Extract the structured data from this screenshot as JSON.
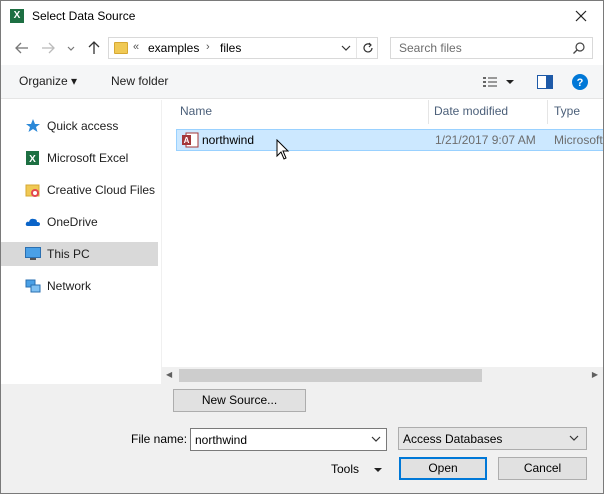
{
  "window": {
    "title": "Select Data Source",
    "app_icon_letter": "X"
  },
  "address": {
    "overflow": "«",
    "crumbs": [
      "examples",
      "files"
    ],
    "search_placeholder": "Search files"
  },
  "toolbar": {
    "organize_label": "Organize ▾",
    "new_folder_label": "New folder"
  },
  "sidebar": {
    "items": [
      {
        "label": "Quick access",
        "icon": "quick-access-star-icon"
      },
      {
        "label": "Microsoft Excel",
        "icon": "excel-icon"
      },
      {
        "label": "Creative Cloud Files",
        "icon": "creative-cloud-folder-icon"
      },
      {
        "label": "OneDrive",
        "icon": "onedrive-cloud-icon"
      },
      {
        "label": "This PC",
        "icon": "this-pc-icon",
        "selected": true
      },
      {
        "label": "Network",
        "icon": "network-icon"
      }
    ]
  },
  "filelist": {
    "columns": [
      "Name",
      "Date modified",
      "Type"
    ],
    "rows": [
      {
        "name": "northwind",
        "date": "1/21/2017 9:07 AM",
        "type": "Microsoft",
        "selected": true
      }
    ]
  },
  "bottom": {
    "new_source_label": "New Source...",
    "file_name_label": "File name:",
    "file_name_value": "northwind",
    "file_type_value": "Access Databases",
    "tools_label": "Tools",
    "open_label": "Open",
    "cancel_label": "Cancel"
  },
  "colors": {
    "selection_bg": "#cce8ff",
    "selection_border": "#99d1ff",
    "primary_border": "#0078d7",
    "excel_green": "#1d6f42",
    "help_blue": "#0078d7"
  }
}
